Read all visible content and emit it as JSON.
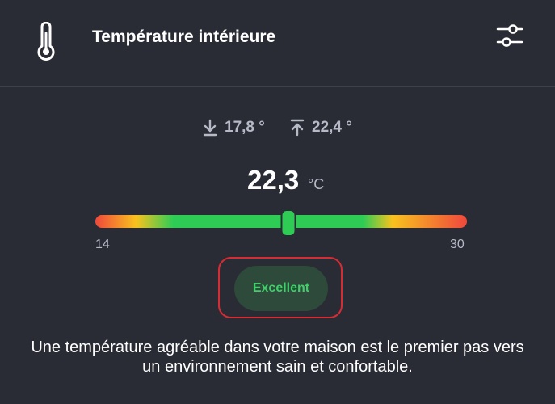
{
  "header": {
    "title": "Température intérieure",
    "thermometer_icon": "thermometer-icon",
    "settings_icon": "sliders-icon"
  },
  "stats": {
    "min": "17,8 °",
    "max": "22,4 °",
    "min_icon": "arrow-down-to-line-icon",
    "max_icon": "arrow-up-from-line-icon"
  },
  "current": {
    "value": "22,3",
    "unit": "°C"
  },
  "gauge": {
    "min_label": "14",
    "max_label": "30",
    "min": 14,
    "max": 30,
    "value": 22.3,
    "colors": {
      "cold": "#f0483c",
      "warn": "#f8c21e",
      "good": "#2ecc55"
    }
  },
  "status": {
    "label": "Excellent",
    "color": "#3fd06a",
    "highlight_color": "#d82c34"
  },
  "description": "Une température agréable dans votre maison est le premier pas vers un environnement sain et confortable."
}
